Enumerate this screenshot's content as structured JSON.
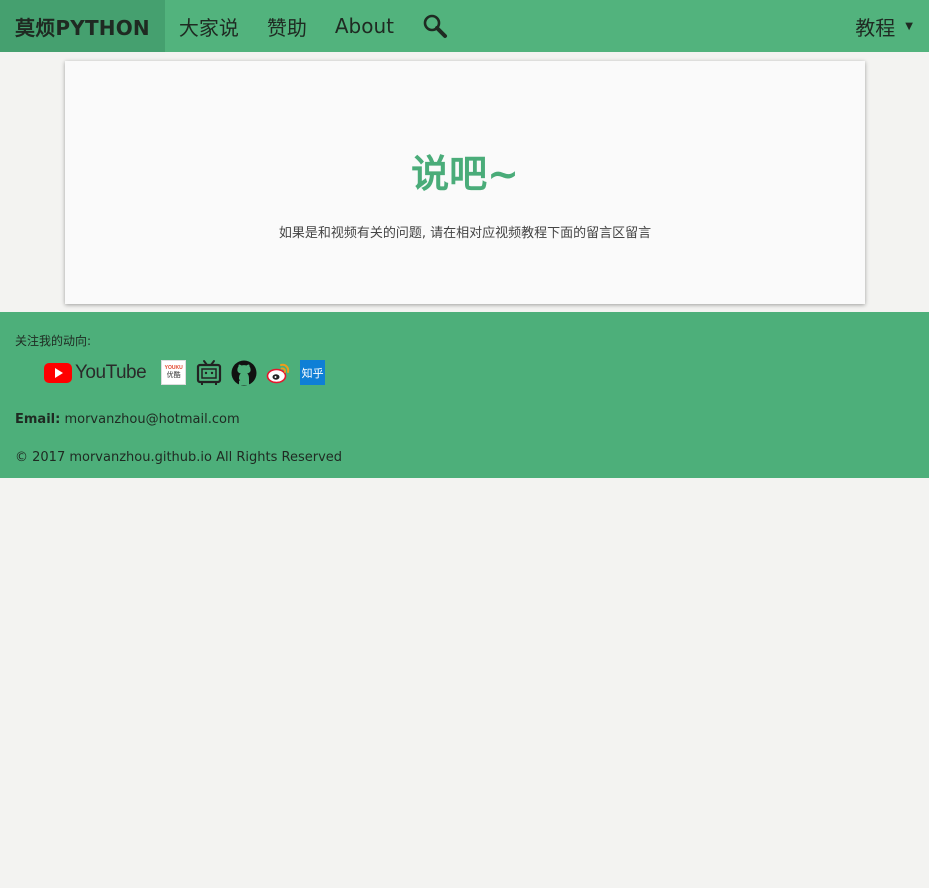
{
  "nav": {
    "brand": "莫烦PYTHON",
    "items": [
      "大家说",
      "赞助",
      "About"
    ],
    "search_icon": "search-icon",
    "tutorials_label": "教程",
    "tutorials_caret": "▼"
  },
  "card": {
    "title": "说吧~",
    "note": "如果是和视频有关的问题, 请在相对应视频教程下面的留言区留言"
  },
  "footer": {
    "follow_label": "关注我的动向:",
    "social": {
      "youtube_text": "YouTube",
      "youku_top": "YOUKU",
      "youku_bottom": "优酷",
      "zhihu_text": "知乎"
    },
    "email_label": "Email:",
    "email_value": "morvanzhou@hotmail.com",
    "copyright": "© 2017 morvanzhou.github.io All Rights Reserved"
  },
  "colors": {
    "nav_bg": "#52b37d",
    "brand_bg": "#45a06f",
    "accent": "#4aac79",
    "footer_bg": "#4daf7a",
    "page_bg": "#f3f3f1"
  }
}
